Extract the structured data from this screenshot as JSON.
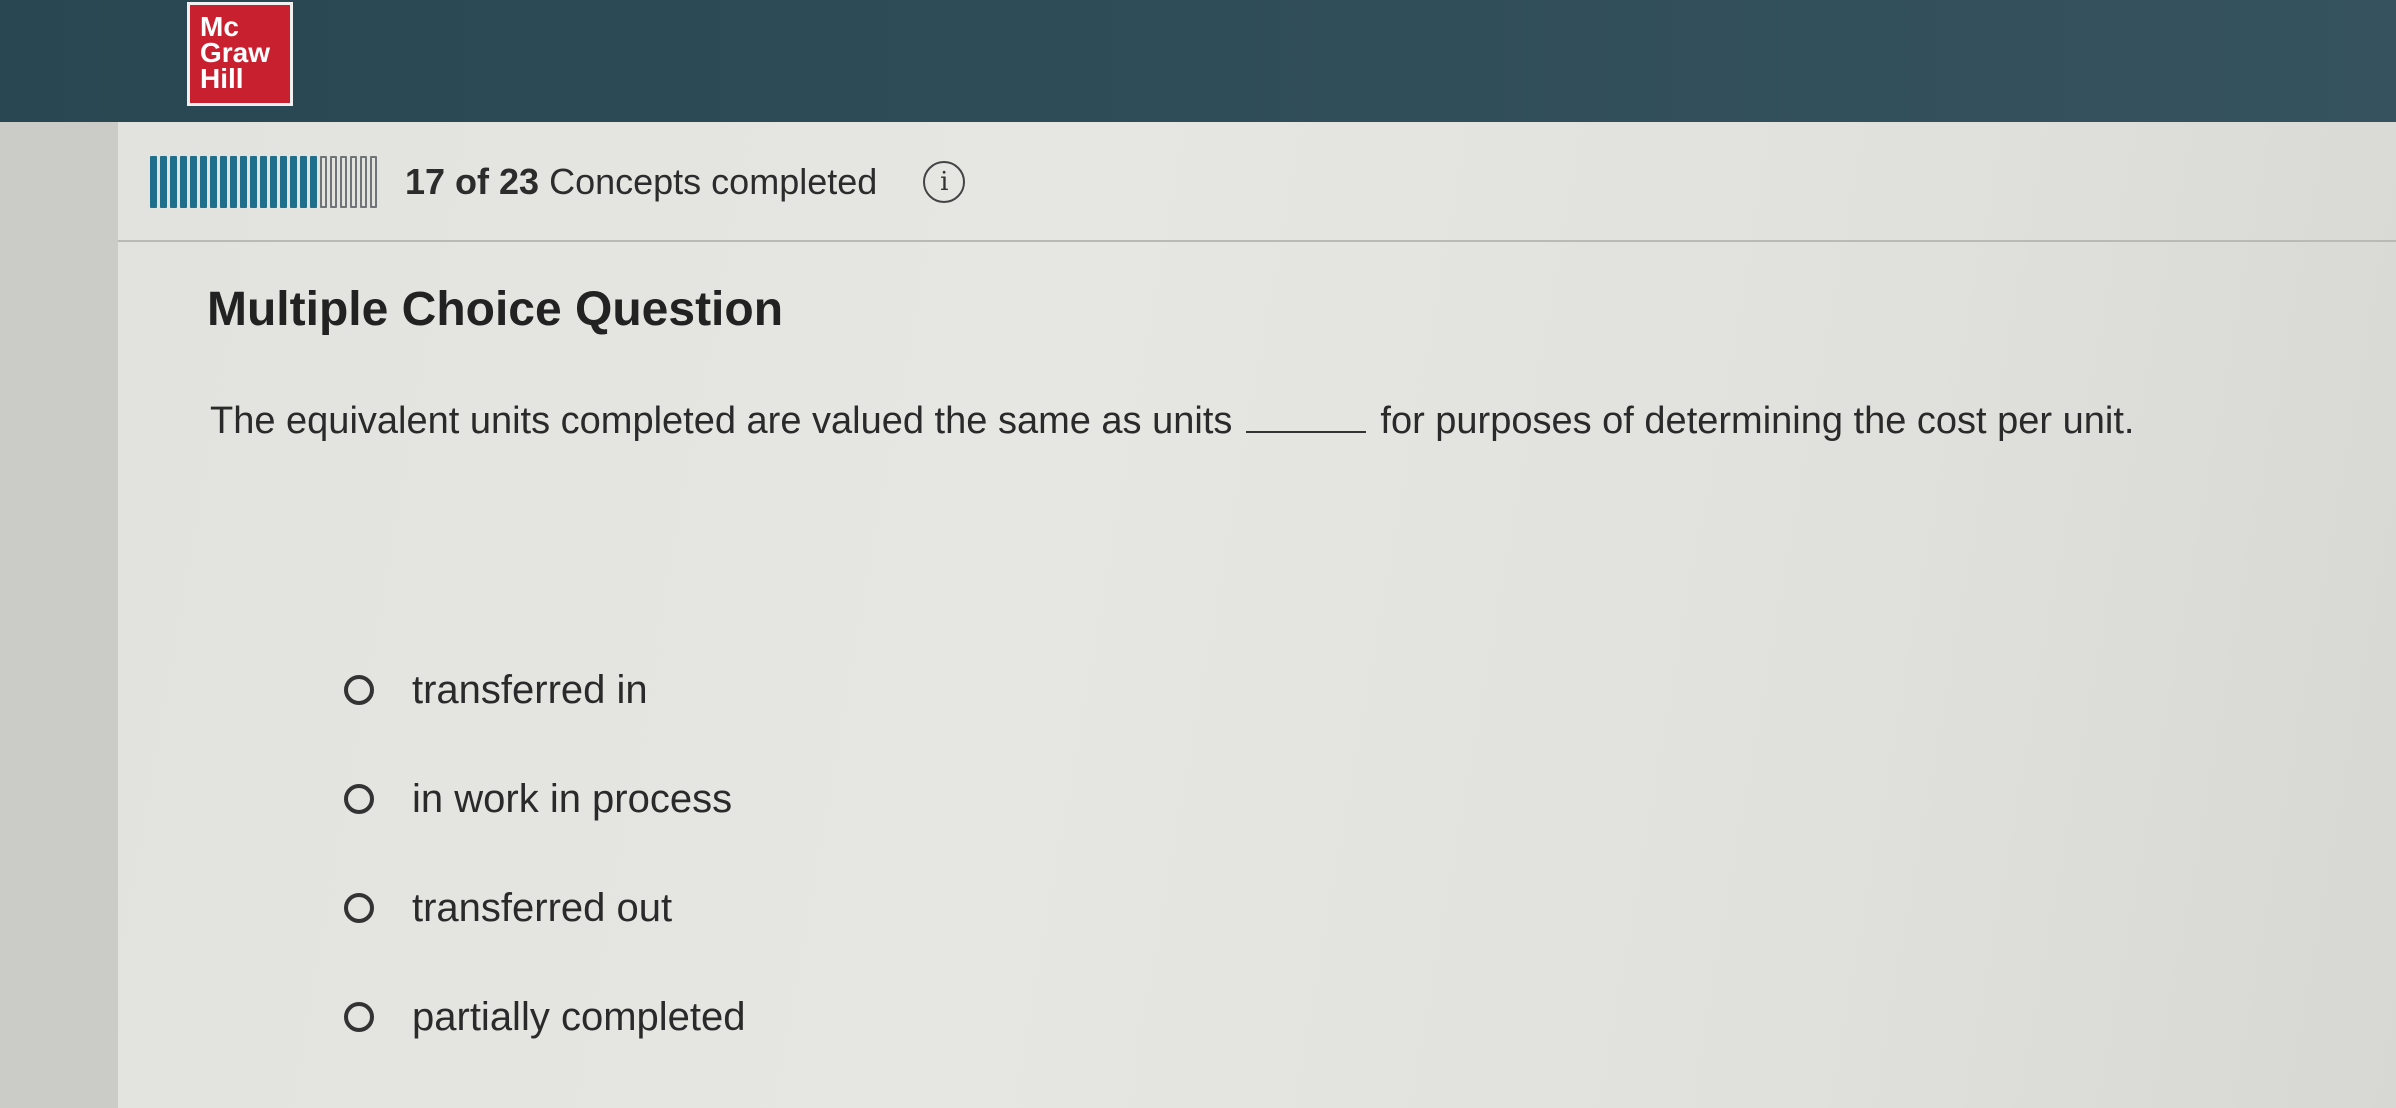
{
  "brand": {
    "logo_lines": [
      "Mc",
      "Graw",
      "Hill"
    ],
    "color": "#c8202f"
  },
  "progress": {
    "completed": 17,
    "total": 23,
    "count_text": "17 of 23",
    "label": "Concepts completed",
    "info_icon": "info-icon",
    "done_color": "#1f6e8c"
  },
  "question": {
    "type_heading": "Multiple Choice Question",
    "text_before": "The equivalent units completed are valued the same as units",
    "text_after": "for purposes of determining the cost per unit."
  },
  "options": [
    {
      "label": "transferred in"
    },
    {
      "label": "in work in process"
    },
    {
      "label": "transferred out"
    },
    {
      "label": "partially completed"
    }
  ]
}
